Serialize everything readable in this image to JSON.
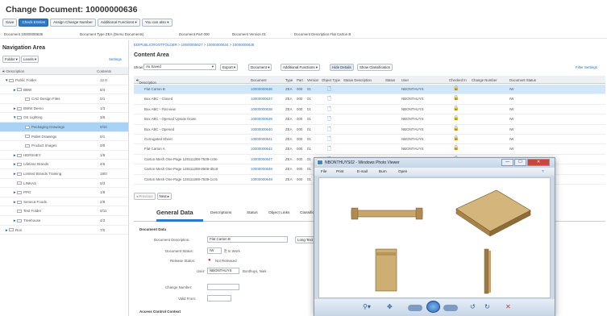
{
  "header": {
    "title": "Change Document: 10000000636",
    "buttons": [
      "Save",
      "Check Entries",
      "Assign Change Number",
      "Additional Functions",
      "You can also"
    ]
  },
  "meta": {
    "document": "Document 10000000636",
    "doctype": "Document Type ZEA (Demo Documents)",
    "part": "Document Part 000",
    "version": "Document Version 01",
    "description": "Document Description Flat Carton B"
  },
  "nav": {
    "title": "Navigation Area",
    "folder_btn": "Folder",
    "levels_btn": "Levels",
    "settings": "Settings",
    "col_desc": "Description",
    "col_contents": "Contents",
    "items": [
      {
        "label": "Public Folder",
        "count": "12.0",
        "indent": 0,
        "exp": "▼"
      },
      {
        "label": "BBW",
        "count": "8/4",
        "indent": 1,
        "exp": "►"
      },
      {
        "label": "CAD Design Files",
        "count": "0/1",
        "indent": 2,
        "exp": ""
      },
      {
        "label": "BWW Demo",
        "count": "1/3",
        "indent": 1,
        "exp": "►"
      },
      {
        "label": "GE Lighting",
        "count": "3/6",
        "indent": 1,
        "exp": "▼"
      },
      {
        "label": "Packaging Drawings",
        "count": "0/10",
        "indent": 2,
        "exp": ""
      },
      {
        "label": "Pallet Drawings",
        "count": "0/1",
        "indent": 2,
        "exp": ""
      },
      {
        "label": "Product Images",
        "count": "0/8",
        "indent": 2,
        "exp": ""
      },
      {
        "label": "HERSHEY",
        "count": "1/8",
        "indent": 1,
        "exp": "►"
      },
      {
        "label": "Lifetime Brands",
        "count": "4/6",
        "indent": 1,
        "exp": "►"
      },
      {
        "label": "Limited Brands Training",
        "count": "18/0",
        "indent": 1,
        "exp": "►"
      },
      {
        "label": "LINKAS",
        "count": "0/3",
        "indent": 1,
        "exp": ""
      },
      {
        "label": "PPG",
        "count": "1/8",
        "indent": 1,
        "exp": "►"
      },
      {
        "label": "Seneca Foods",
        "count": "2/8",
        "indent": 1,
        "exp": "►"
      },
      {
        "label": "Test Folder",
        "count": "0/11",
        "indent": 1,
        "exp": ""
      },
      {
        "label": "Treehouse",
        "count": "4/3",
        "indent": 1,
        "exp": "►"
      },
      {
        "label": "Ron",
        "count": "7/0",
        "indent": 0,
        "exp": "►"
      }
    ]
  },
  "content": {
    "breadcrumb": "EDIPUBLICROOTFOLDER > 10000000627 > 10000000634 > 10000000636",
    "title": "Content Area",
    "show_label": "Show:",
    "show_value": "As Saved",
    "tools": [
      "Export",
      "Document",
      "Additional Functions",
      "Hide Details",
      "Show Classification"
    ],
    "filter": "Filter Settings",
    "columns": [
      "Description",
      "Document",
      "Type",
      "Part",
      "Version",
      "Object Type",
      "Status Description",
      "Status",
      "User",
      "Checked In",
      "Change Number",
      "Document Status"
    ],
    "rows": [
      {
        "desc": "Flat Carton B",
        "doc": "10000000636",
        "type": "ZEA",
        "part": "000",
        "ver": "01",
        "user": "NBONTHUYS",
        "status": "IW"
      },
      {
        "desc": "Box ABC - Closed",
        "doc": "10000000637",
        "type": "ZEA",
        "part": "000",
        "ver": "01",
        "user": "NBONTHUYS",
        "status": "IW"
      },
      {
        "desc": "Box ABC - Flat view",
        "doc": "10000000638",
        "type": "ZEA",
        "part": "000",
        "ver": "01",
        "user": "NBONTHUYS",
        "status": "IW"
      },
      {
        "desc": "Box ABC - Opened Upside Down",
        "doc": "10000000639",
        "type": "ZEA",
        "part": "000",
        "ver": "01",
        "user": "NBONTHUYS",
        "status": "IW"
      },
      {
        "desc": "Box ABC - Opened",
        "doc": "10000000640",
        "type": "ZEA",
        "part": "000",
        "ver": "01",
        "user": "NBONTHUYS",
        "status": "IW"
      },
      {
        "desc": "Corrugated Sheet",
        "doc": "10000000641",
        "type": "ZEA",
        "part": "000",
        "ver": "01",
        "user": "NBONTHUYS",
        "status": "IW"
      },
      {
        "desc": "Flat Carton A",
        "doc": "10000000642",
        "type": "ZEA",
        "part": "000",
        "ver": "01",
        "user": "NBONTHUYS",
        "status": "IW"
      },
      {
        "desc": "Carton Mesh One-Page 128111288-7539-cc0e",
        "doc": "10000000647",
        "type": "ZEA",
        "part": "000",
        "ver": "01",
        "user": "NBONTHUYS",
        "status": "IW"
      },
      {
        "desc": "Carton Mesh One-Page 128111288-8506-d5c8",
        "doc": "10000000648",
        "type": "ZEA",
        "part": "000",
        "ver": "01",
        "user": "NBONTHUYS",
        "status": "IW"
      },
      {
        "desc": "Carton Mesh One-Page 128111288-7539-1cc5",
        "doc": "10000000649",
        "type": "ZEA",
        "part": "000",
        "ver": "01",
        "user": "NBONTHUYS",
        "status": "IW"
      }
    ],
    "pager_prev": "Previous",
    "pager_next": "Next"
  },
  "tabs": [
    "General Data",
    "Descriptions",
    "Status",
    "Object Links",
    "Classification"
  ],
  "general": {
    "section": "Document Data",
    "desc_label": "Document Description:",
    "desc_value": "Flat Carton B",
    "long_text": "Long Text",
    "status_label": "Document Status:",
    "status_value": "IW",
    "status_text": "In Work",
    "release_label": "Release Status:",
    "release_value": "Not Released",
    "user_label": "User:",
    "user_value": "NBONTHUYS",
    "user_name": "Bonthuys, Niek",
    "change_label": "Change Number:",
    "valid_label": "Valid From:",
    "access_section": "Access Control Context"
  },
  "viewer": {
    "title": "NBONTHUYS02 - Windows Photo Viewer",
    "menu": [
      "File",
      "Print",
      "E-mail",
      "Burn",
      "Open"
    ],
    "min": "—",
    "max": "☐",
    "close": "✕"
  },
  "colors": {
    "accent": "#2f78c8",
    "selected_row": "#cfe6fb",
    "tree_selected": "#a9d3f5"
  }
}
